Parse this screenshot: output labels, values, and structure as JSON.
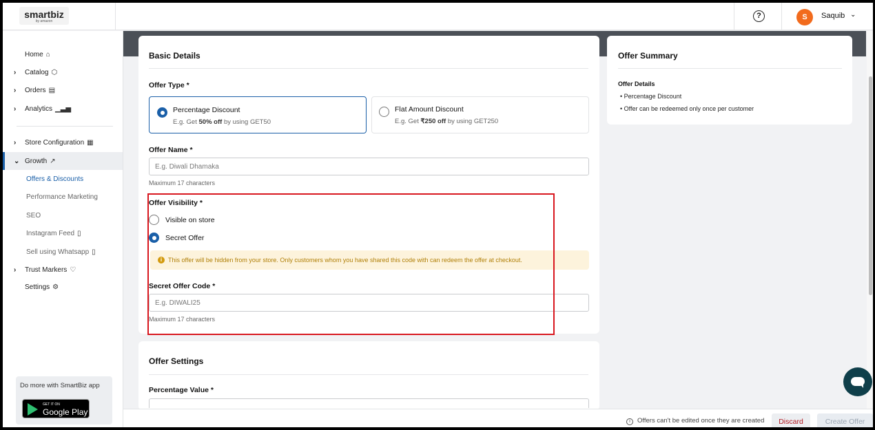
{
  "app": {
    "brand": "smartbiz",
    "brand_sub": "by amazon",
    "user_initial": "S",
    "user_name": "Saquib"
  },
  "sidebar": {
    "items": [
      {
        "label": "Home",
        "icon": "home-icon"
      },
      {
        "label": "Catalog",
        "icon": "cube-icon"
      },
      {
        "label": "Orders",
        "icon": "clipboard-icon"
      },
      {
        "label": "Analytics",
        "icon": "bar-chart-icon"
      },
      {
        "label": "Store Configuration",
        "icon": "store-icon"
      },
      {
        "label": "Growth",
        "icon": "trend-up-icon"
      },
      {
        "label": "Offers & Discounts"
      },
      {
        "label": "Performance Marketing"
      },
      {
        "label": "SEO"
      },
      {
        "label": "Instagram Feed",
        "icon": "mobile-icon"
      },
      {
        "label": "Sell using Whatsapp",
        "icon": "mobile-icon"
      },
      {
        "label": "Trust Markers",
        "icon": "badge-icon"
      },
      {
        "label": "Settings",
        "icon": "gear-icon"
      }
    ],
    "promo_text": "Do more with SmartBiz app",
    "gplay_small": "GET IT ON",
    "gplay_big": "Google Play"
  },
  "basic_details": {
    "title": "Basic Details",
    "offer_type_label": "Offer Type *",
    "options": [
      {
        "title": "Percentage Discount",
        "desc_pre": "E.g. Get",
        "desc_bold": "50% off",
        "desc_post": "by using GET50",
        "selected": true
      },
      {
        "title": "Flat Amount Discount",
        "desc_pre": "E.g. Get",
        "desc_bold": "₹250 off",
        "desc_post": "by using GET250",
        "selected": false
      }
    ],
    "offer_name_label": "Offer Name *",
    "offer_name_placeholder": "E.g. Diwali Dhamaka",
    "offer_name_helper": "Maximum 17 characters",
    "visibility_label": "Offer Visibility *",
    "visibility_options": [
      {
        "label": "Visible on store",
        "selected": false
      },
      {
        "label": "Secret Offer",
        "selected": true
      }
    ],
    "warning": "This offer will be hidden from your store. Only customers whom you have shared this code with can redeem the offer at checkout.",
    "secret_code_label": "Secret Offer Code *",
    "secret_code_placeholder": "E.g. DIWALI25",
    "secret_code_helper": "Maximum 17 characters"
  },
  "offer_settings": {
    "title": "Offer Settings",
    "percentage_label": "Percentage Value *"
  },
  "summary": {
    "title": "Offer Summary",
    "details_heading": "Offer Details",
    "items": [
      "Percentage Discount",
      "Offer can be redeemed only once per customer"
    ]
  },
  "footer": {
    "info": "Offers can't be edited once they are created",
    "discard": "Discard",
    "create": "Create Offer"
  },
  "colors": {
    "accent": "#1a5fa8",
    "highlight": "#d8161e",
    "avatar": "#f26b1d",
    "warning_bg": "#fdf3dc"
  }
}
